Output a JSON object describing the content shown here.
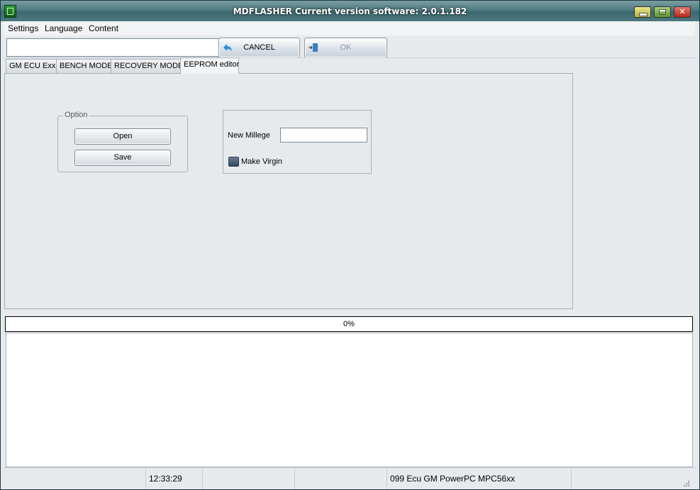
{
  "window": {
    "title": "MDFLASHER  Current version software: 2.0.1.182",
    "controls": {
      "minimize": "minimize-icon",
      "maximize": "maximize-icon",
      "close": "✕"
    }
  },
  "menu": {
    "items": [
      "Settings",
      "Language",
      "Content"
    ]
  },
  "toolbar": {
    "input_value": "",
    "cancel_label": "CANCEL",
    "ok_label": "OK",
    "cancel_icon": "back-arrow-icon",
    "ok_icon": "exit-door-icon"
  },
  "tabs": [
    {
      "label": "GM ECU Exx",
      "active": false
    },
    {
      "label": "BENCH MODE",
      "active": false
    },
    {
      "label": "RECOVERY MODE",
      "active": false
    },
    {
      "label": "EEPROM editor",
      "active": true
    }
  ],
  "eeprom_editor": {
    "option_group": {
      "legend": "Option",
      "open_label": "Open",
      "save_label": "Save"
    },
    "mileage": {
      "label": "New Millege",
      "value": ""
    },
    "make_virgin": {
      "label": "Make Virgin",
      "checked": true
    }
  },
  "progress": {
    "text": "0%",
    "value": 0
  },
  "log": {
    "text": ""
  },
  "status": {
    "cells": [
      "",
      "12:33:29",
      "",
      "",
      "099 Ecu GM PowerPC MPC56xx",
      ""
    ]
  },
  "colors": {
    "accent": "#4f7b82",
    "progress_border": "#000000"
  }
}
